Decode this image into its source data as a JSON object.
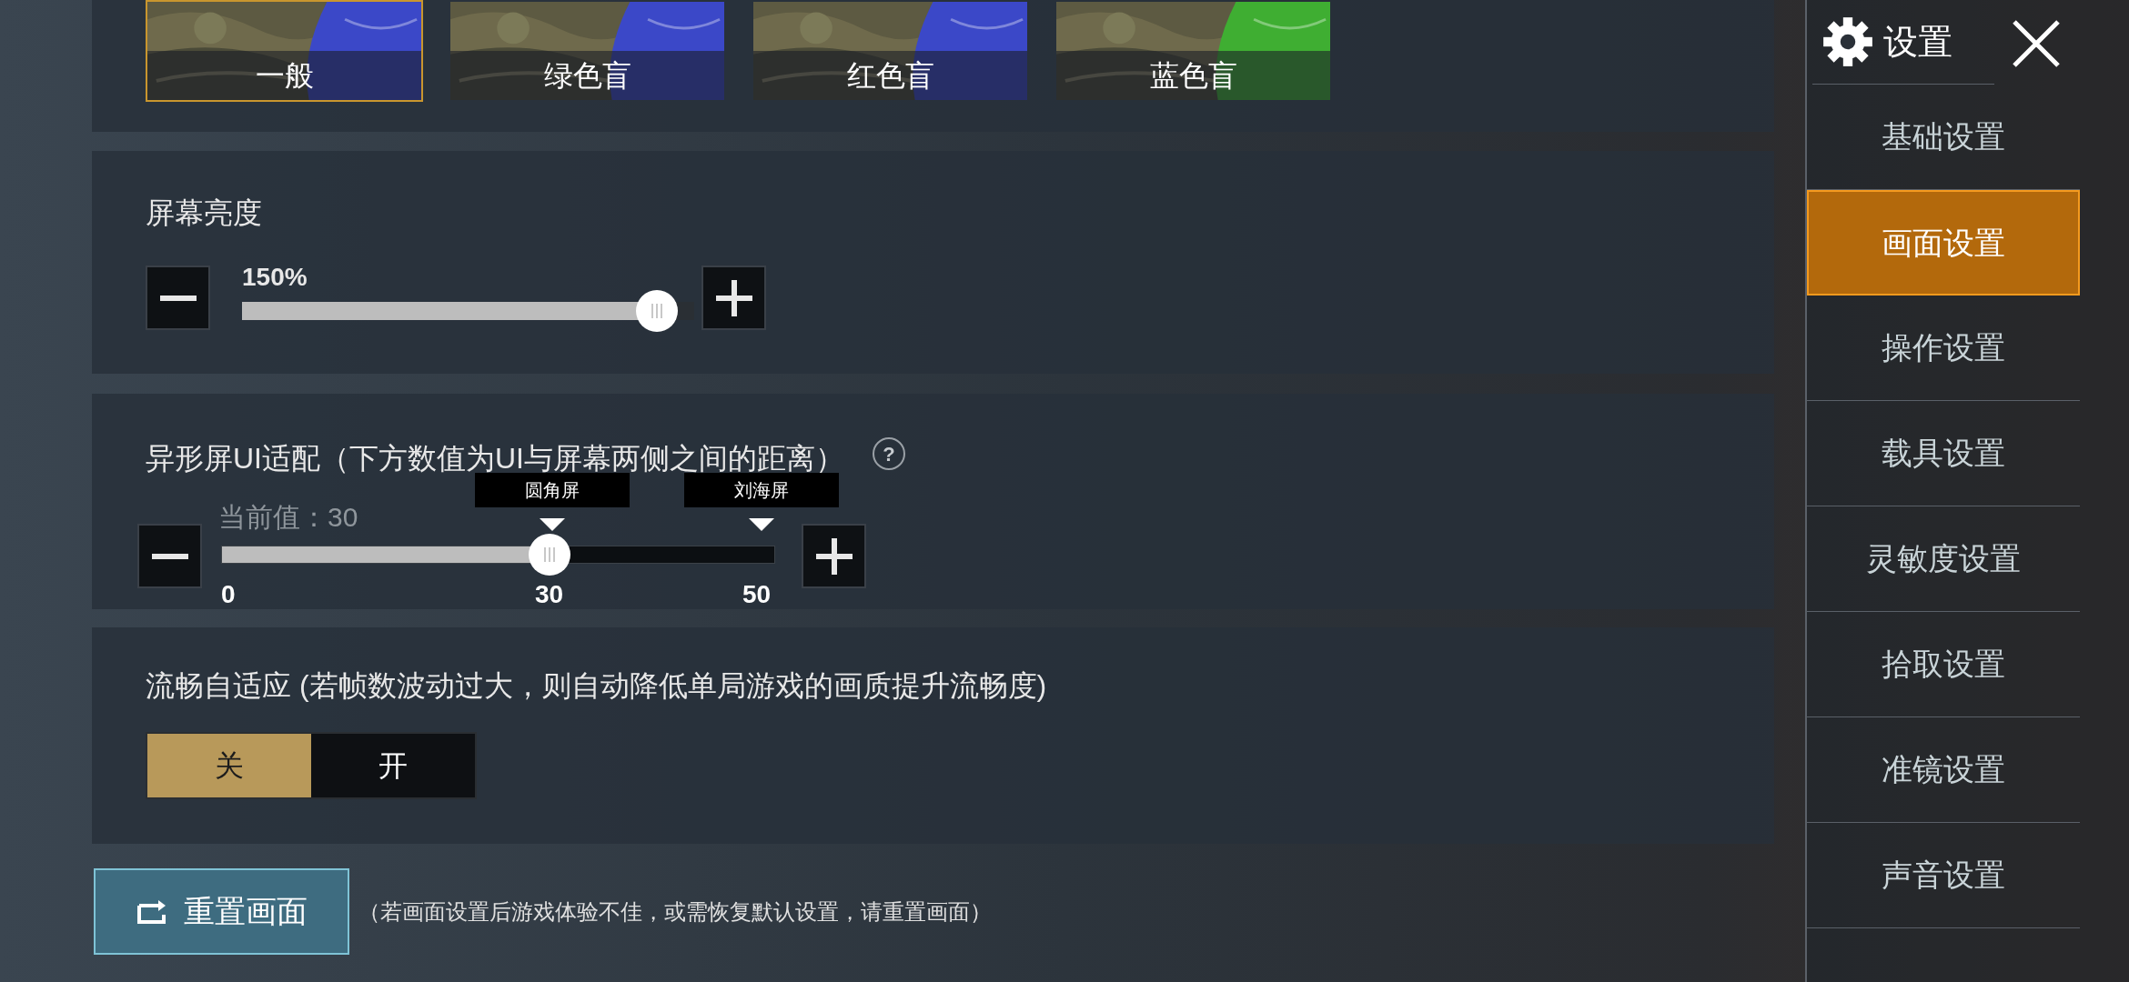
{
  "color_modes": [
    {
      "label": "一般",
      "color": "#3b48c8",
      "selected": true
    },
    {
      "label": "绿色盲",
      "color": "#3b48c8",
      "selected": false
    },
    {
      "label": "红色盲",
      "color": "#3b48c8",
      "selected": false
    },
    {
      "label": "蓝色盲",
      "color": "#3fae32",
      "selected": false
    }
  ],
  "brightness": {
    "title": "屏幕亮度",
    "reading": "150%",
    "level": 0.96
  },
  "notch": {
    "title": "异形屏UI适配（下方数值为UI与屏幕两侧之间的距离）",
    "help": "?",
    "current": "当前值：30",
    "level": 0.6,
    "markers": [
      {
        "label": "圆角屏"
      },
      {
        "label": "刘海屏"
      }
    ],
    "ticks": [
      "0",
      "30",
      "50"
    ]
  },
  "smooth": {
    "title": "流畅自适应 (若帧数波动过大，则自动降低单局游戏的画质提升流畅度)",
    "options": [
      {
        "label": "关",
        "selected": true
      },
      {
        "label": "开",
        "selected": false
      }
    ]
  },
  "reset": {
    "button": "重置画面",
    "note": "（若画面设置后游戏体验不佳，或需恢复默认设置，请重置画面）"
  },
  "sidebar": {
    "title": "设置",
    "items": [
      {
        "label": "基础设置",
        "selected": false
      },
      {
        "label": "画面设置",
        "selected": true
      },
      {
        "label": "操作设置",
        "selected": false
      },
      {
        "label": "载具设置",
        "selected": false
      },
      {
        "label": "灵敏度设置",
        "selected": false
      },
      {
        "label": "拾取设置",
        "selected": false
      },
      {
        "label": "准镜设置",
        "selected": false
      },
      {
        "label": "声音设置",
        "selected": false
      }
    ]
  }
}
